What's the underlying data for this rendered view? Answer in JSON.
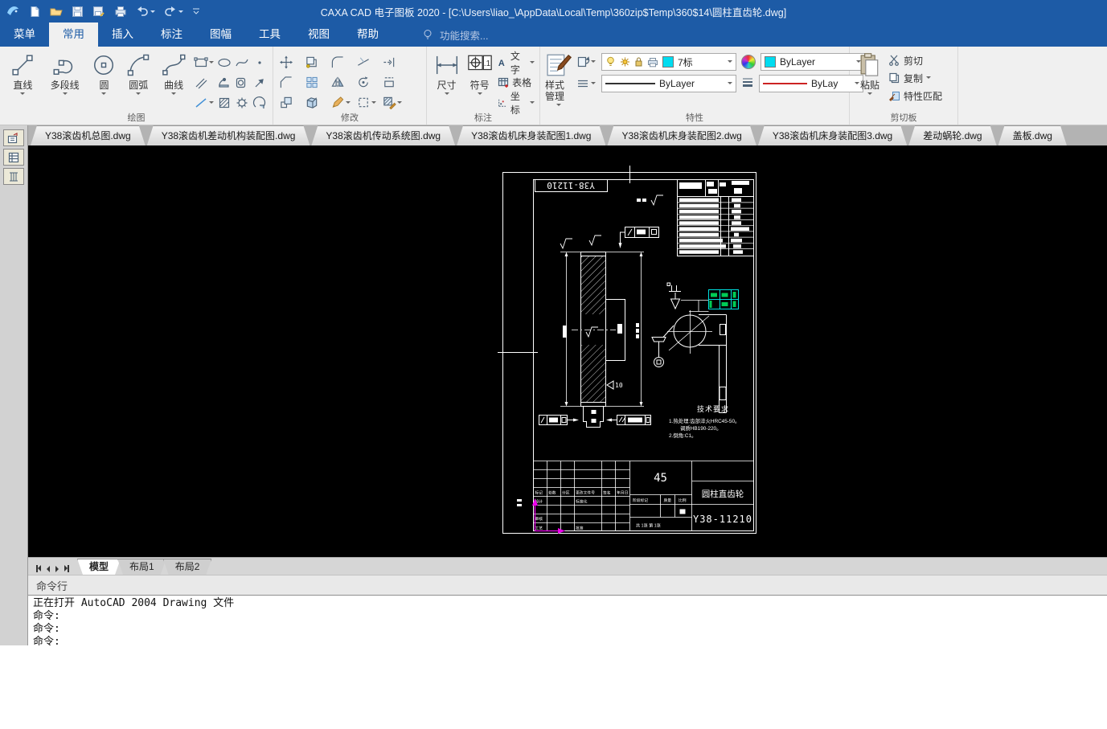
{
  "window": {
    "title": "CAXA CAD 电子图板 2020 - [C:\\Users\\liao_\\AppData\\Local\\Temp\\360zip$Temp\\360$14\\圆柱直齿轮.dwg]"
  },
  "menu": {
    "tabs": [
      "菜单",
      "常用",
      "插入",
      "标注",
      "图幅",
      "工具",
      "视图",
      "帮助"
    ],
    "active_tab": "常用",
    "search_hint": "功能搜索..."
  },
  "ribbon": {
    "draw": {
      "label": "绘图",
      "buttons": [
        "直线",
        "多段线",
        "圆",
        "圆弧",
        "曲线"
      ]
    },
    "modify": {
      "label": "修改"
    },
    "annotate": {
      "label": "标注",
      "dimension": "尺寸",
      "symbol": "符号",
      "text": "文字",
      "table": "表格",
      "coordinate": "坐标"
    },
    "properties": {
      "label": "特性",
      "style_manager": "样式管理",
      "layer": "7标",
      "color": "ByLayer",
      "linetype": "ByLayer",
      "lineweight": "ByLay"
    },
    "clipboard": {
      "label": "剪切板",
      "paste": "粘贴",
      "cut": "剪切",
      "copy": "复制",
      "match_properties": "特性匹配"
    }
  },
  "doc_tabs": [
    "Y38滚齿机总图.dwg",
    "Y38滚齿机差动机构装配图.dwg",
    "Y38滚齿机传动系统图.dwg",
    "Y38滚齿机床身装配图1.dwg",
    "Y38滚齿机床身装配图2.dwg",
    "Y38滚齿机床身装配图3.dwg",
    "差动蜗轮.dwg",
    "盖板.dwg"
  ],
  "drawing": {
    "code": "Y38-11210",
    "code_mirrored": "Y38-11210",
    "material": "45",
    "part_name": "圆柱直齿轮",
    "dim_note": "10",
    "tech": {
      "title": "技术要求",
      "line1": "1.热处理:齿部淬火HRC45-50。",
      "line2": "调质HB190-220。",
      "line3": "2.倒角:C1。"
    },
    "titleblock": {
      "mark": "标记",
      "count": "处数",
      "zone": "分区",
      "change_no": "更改文件号",
      "sign": "签名",
      "date": "年月日",
      "design": "设计",
      "standardize": "标准化",
      "review": "审核",
      "process": "工艺",
      "approve": "批准",
      "stage": "阶段标记",
      "weight": "质量",
      "scale": "比例",
      "sheets": "共 1张 第 1张"
    }
  },
  "layout_tabs": {
    "items": [
      "模型",
      "布局1",
      "布局2"
    ],
    "active": "模型"
  },
  "command": {
    "header": "命令行",
    "lines": [
      "正在打开 AutoCAD 2004 Drawing 文件",
      "命令:",
      "命令:",
      "命令:"
    ]
  },
  "colors": {
    "titlebar": "#1d5ba6",
    "layer_color": "#00dcf0",
    "lineweight_color": "#cc2222",
    "highlight_green": "#00cc55",
    "frame_cyan": "#00e0e0",
    "ucs": "#ee00ee"
  }
}
